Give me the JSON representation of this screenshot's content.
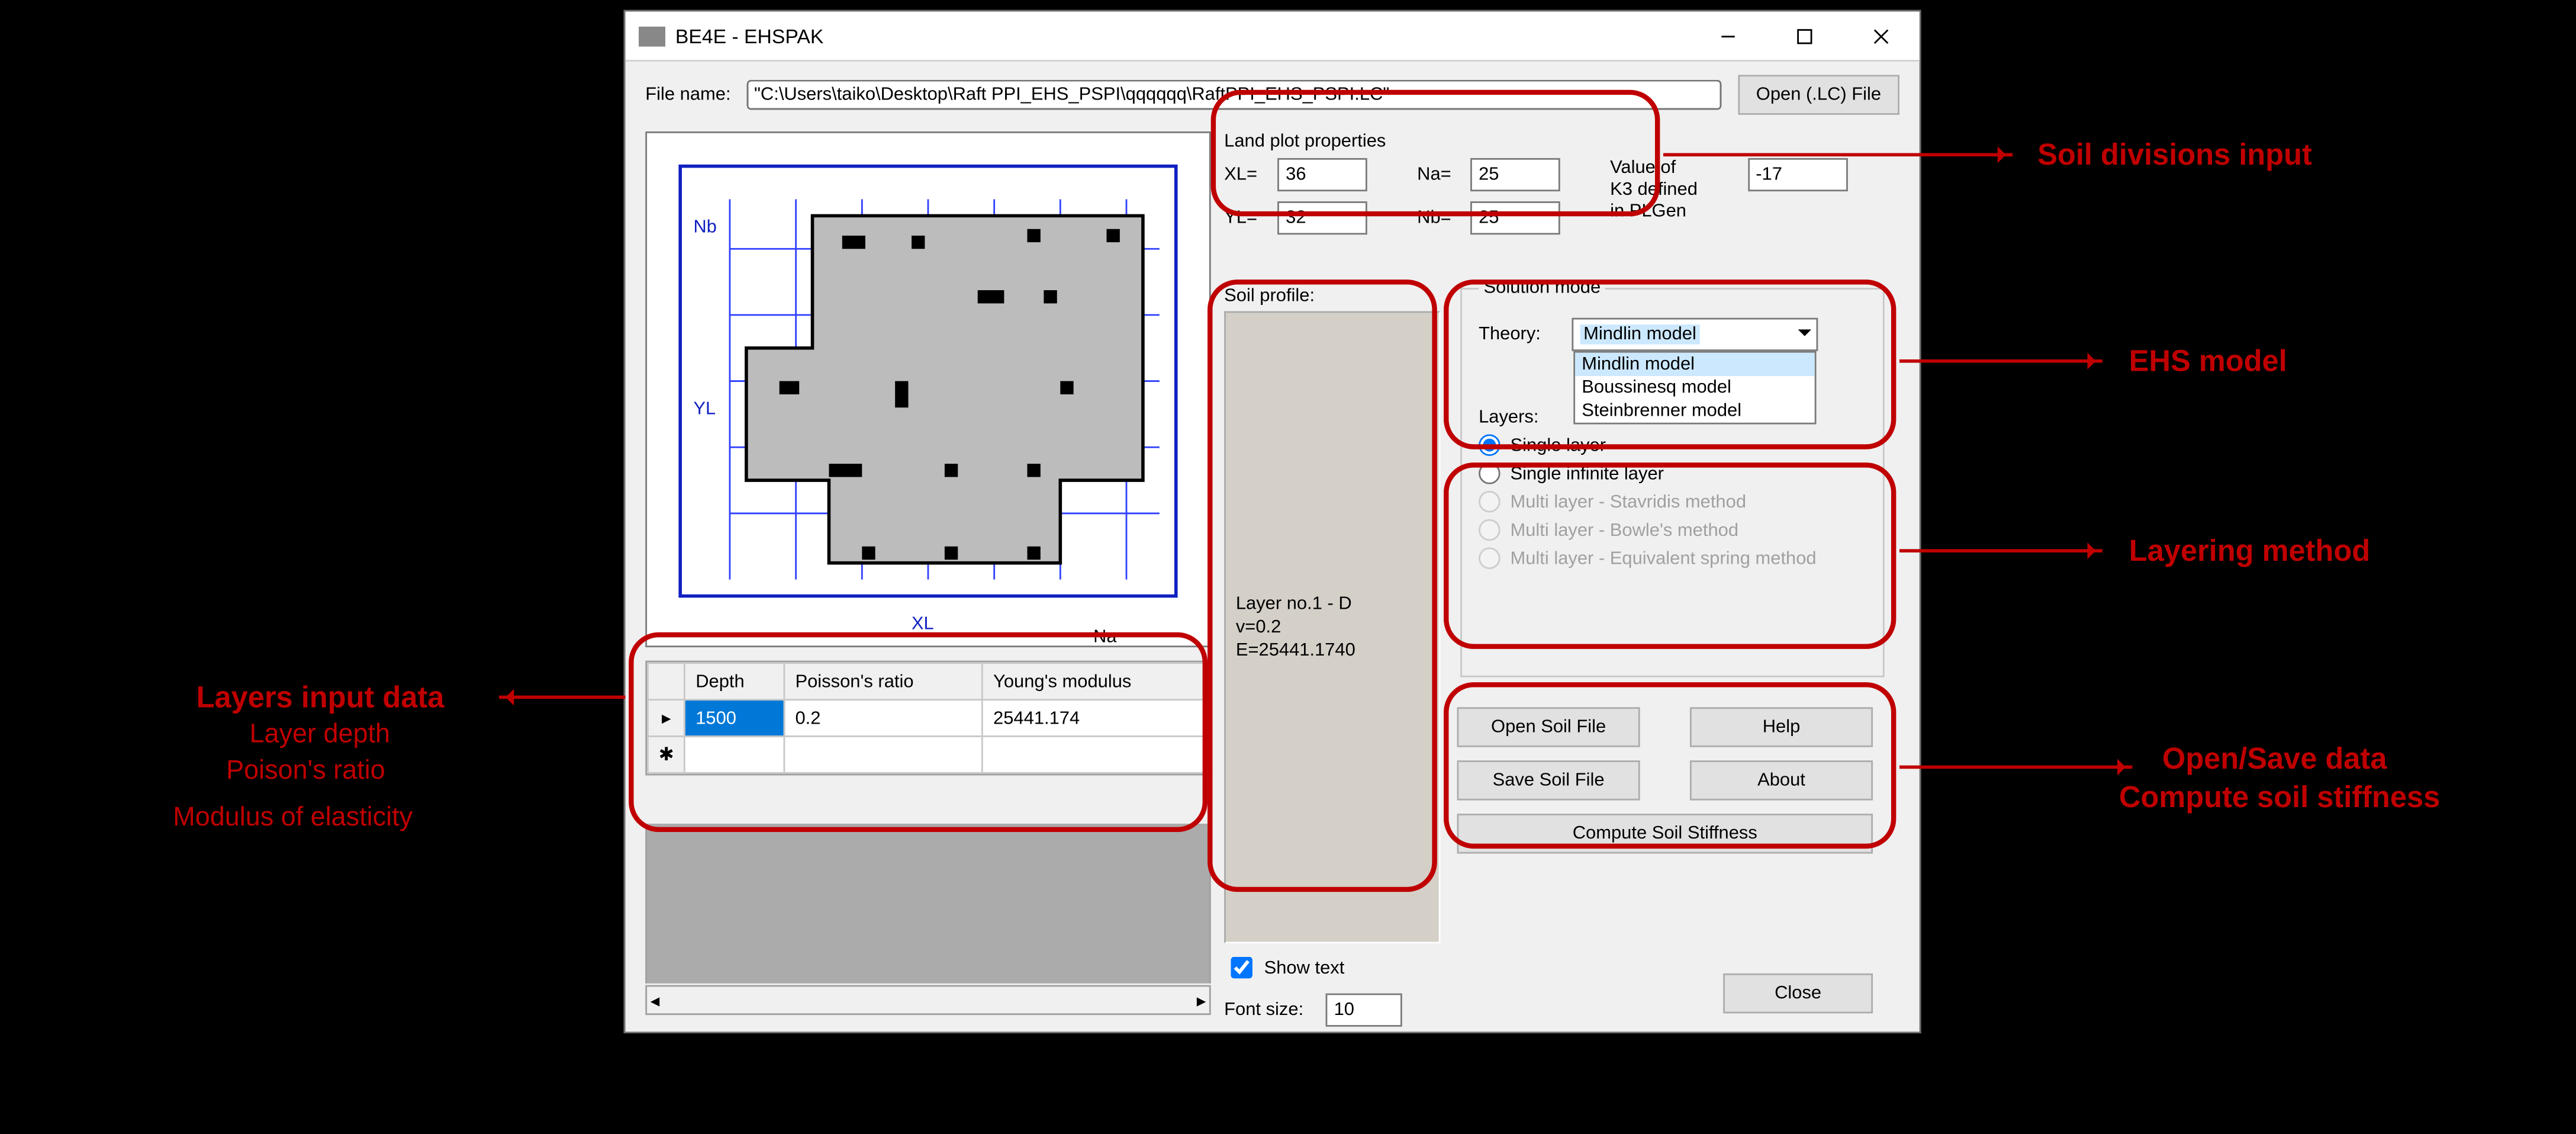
{
  "window": {
    "title": "BE4E - EHSPAK"
  },
  "file": {
    "label": "File name:",
    "path": "\"C:\\Users\\taiko\\Desktop\\Raft PPI_EHS_PSPI\\qqqqqq\\RaftPPI_EHS_PSPI.LC\"",
    "open_btn": "Open (.LC) File"
  },
  "landplot": {
    "title": "Land plot properties",
    "xl_label": "XL=",
    "xl": "36",
    "yl_label": "YL=",
    "yl": "32",
    "na_label": "Na=",
    "na": "25",
    "nb_label": "Nb=",
    "nb": "25",
    "k3_label_1": "Value of",
    "k3_label_2": "K3 defined",
    "k3_label_3": "in PLGen",
    "k3": "-17"
  },
  "profile": {
    "title": "Soil profile:",
    "layer_line1": "Layer no.1 - D",
    "layer_line2": "v=0.2",
    "layer_line3": "E=25441.1740"
  },
  "solution": {
    "title": "Solution mode",
    "theory_label": "Theory:",
    "theory_selected": "Mindlin model",
    "theory_options": [
      "Mindlin model",
      "Boussinesq model",
      "Steinbrenner model"
    ],
    "layers_label": "Layers:",
    "layer_opts": {
      "single": "Single layer",
      "single_inf": "Single infinite layer",
      "stav": "Multi layer - Stavridis method",
      "bowle": "Multi layer  - Bowle's method",
      "spring": "Multi layer - Equivalent spring method"
    }
  },
  "buttons": {
    "open_soil": "Open Soil File",
    "save_soil": "Save Soil File",
    "help": "Help",
    "about": "About",
    "compute": "Compute Soil Stiffness",
    "close": "Close"
  },
  "showtext": {
    "label": "Show text",
    "fontlabel": "Font size:",
    "fontsize": "10"
  },
  "grid": {
    "headers": [
      "Depth",
      "Poisson's ratio",
      "Young's modulus"
    ],
    "row": {
      "depth": "1500",
      "poisson": "0.2",
      "young": "25441.174"
    }
  },
  "preview_labels": {
    "nb": "Nb",
    "yl": "YL",
    "xl": "XL",
    "na": "Na"
  },
  "annotations": {
    "soil_div": "Soil divisions input",
    "ehs": "EHS model",
    "layering": "Layering method",
    "opensave1": "Open/Save data",
    "opensave2": "Compute soil stiffness",
    "layers_title": "Layers input data",
    "layers_l1": "Layer depth",
    "layers_l2": "Poison's ratio",
    "layers_l3": "Modulus of elasticity"
  }
}
